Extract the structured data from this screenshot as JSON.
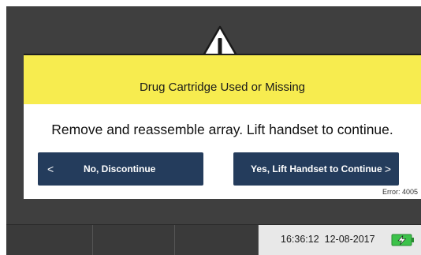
{
  "alert": {
    "title": "Drug Cartridge Used or Missing",
    "message": "Remove and reassemble array. Lift handset to continue.",
    "error_code": "Error: 4005",
    "icon": "warning-triangle-icon"
  },
  "buttons": {
    "no": {
      "chevron": "<",
      "label": "No, Discontinue"
    },
    "yes": {
      "chevron": ">",
      "label": "Yes, Lift Handset to Continue"
    }
  },
  "status_bar": {
    "time": "16:36:12",
    "date": "12-08-2017",
    "battery_icon": "battery-charging-icon"
  },
  "colors": {
    "header_yellow": "#f7ec4f",
    "button_navy": "#243c5c",
    "device_gray": "#3f3f3f",
    "battery_green": "#3cc24a"
  }
}
